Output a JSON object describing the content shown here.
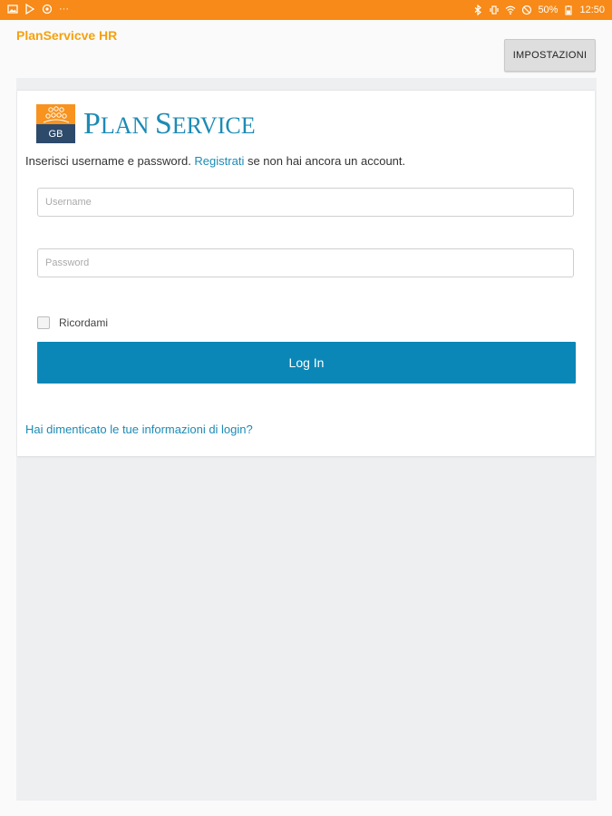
{
  "status_bar": {
    "battery": "50%",
    "time": "12:50",
    "left_icons": [
      "image-icon",
      "play-store-icon",
      "app-icon",
      "more-icon"
    ],
    "right_icons": [
      "bluetooth-icon",
      "vibrate-icon",
      "wifi-icon",
      "alarm-icon"
    ]
  },
  "app": {
    "title": "PlanServicve HR",
    "settings_label": "IMPOSTAZIONI"
  },
  "logo": {
    "badge_text": "GB",
    "brand_p": "P",
    "brand_lan": "LAN ",
    "brand_s": "S",
    "brand_ervice": "ERVICE",
    "brand_color": "#1c8bb5",
    "mark_top_color": "#f7931e",
    "mark_bottom_color": "#2d4a6b"
  },
  "login": {
    "intro_before": "Inserisci username e password. ",
    "intro_link": "Registrati",
    "intro_after": " se non hai ancora un account.",
    "username_placeholder": "Username",
    "password_placeholder": "Password",
    "remember_label": "Ricordami",
    "remember_checked": false,
    "login_button": "Log In",
    "forgot_link": "Hai dimenticato le tue informazioni di login?"
  },
  "colors": {
    "status_bar": "#f78a18",
    "title": "#f5a10f",
    "primary_button": "#0a87b7",
    "link": "#1c8bb5"
  }
}
